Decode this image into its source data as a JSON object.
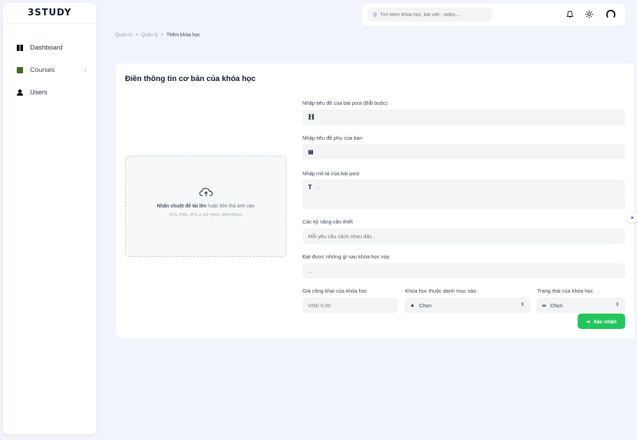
{
  "logo": "3STUDY",
  "sidebar": {
    "items": [
      {
        "label": "Dashboard",
        "icon": "dashboard-icon"
      },
      {
        "label": "Courses",
        "icon": "book-icon",
        "chevron": "‹"
      },
      {
        "label": "Users",
        "icon": "user-icon"
      }
    ]
  },
  "header": {
    "search_placeholder": "Tìm kiếm khóa học, bài viết , video,...",
    "icons": [
      "bell-icon",
      "sun-icon",
      "avatar-icon"
    ]
  },
  "breadcrumb": [
    "Quản trị",
    "Quản lý",
    "Thêm khóa học"
  ],
  "form": {
    "title": "Điền thông tin cơ bản của khóa học",
    "upload": {
      "main_bold": "Nhấn chuột để tải lên",
      "main_rest": "hoặc kéo thả ảnh vào",
      "hint": "SVG, PNG, JPG or GIF (MAX. 800×400px)"
    },
    "fields": {
      "title_label": "Nhập tiêu đề của bài post (Bắt buộc)",
      "title_glyph": "H",
      "subtitle_label": "Nhập tiêu đề phụ của bạn",
      "subtitle_glyph": "▤",
      "desc_label": "Nhập mô tả của bài post",
      "desc_glyph": "T",
      "desc_placeholder": "...",
      "skills_label": "Các kỹ năng cần thiết",
      "skills_placeholder": "Mỗi yêu cầu cách nhau dấu ,",
      "gains_label": "Đạt được những gì sau khóa học này",
      "gains_placeholder": "...",
      "price_label": "Giá công khai của khóa học",
      "price_placeholder": "VND 0.00",
      "category_label": "Khóa học thuộc danh mục nào",
      "category_value": "Chọn",
      "status_label": "Trạng thái của khóa học",
      "status_value": "Chọn"
    },
    "submit": "Xác nhận"
  },
  "colors": {
    "accent": "#22c55e",
    "background": "#f1f4fb"
  }
}
